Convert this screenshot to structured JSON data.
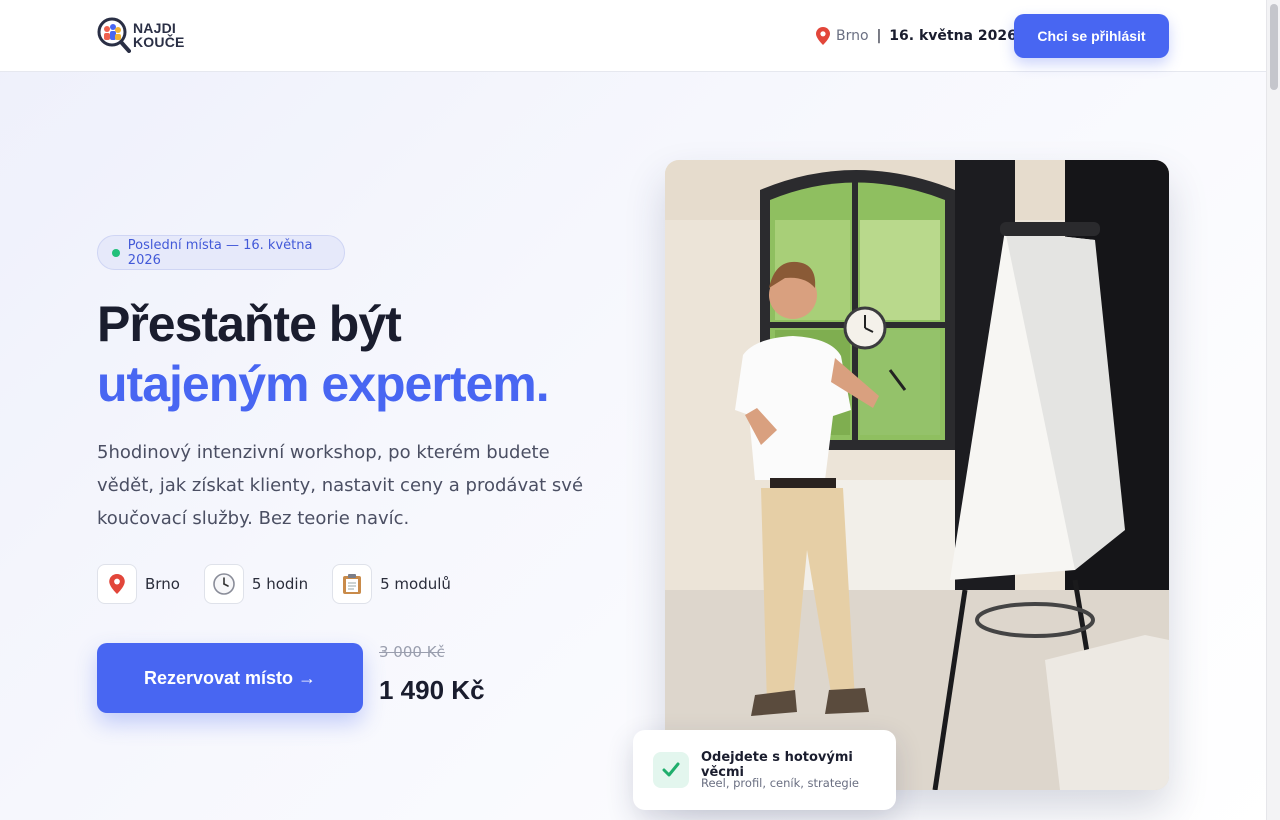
{
  "header": {
    "logo_line1": "NAJDI",
    "logo_line2": "KOUČE",
    "city": "Brno",
    "separator": "|",
    "date": "16. května 2026",
    "signup_label": "Chci se přihlásit"
  },
  "hero": {
    "badge": "Poslední místa — 16. května 2026",
    "headline_line1": "Přestaňte být",
    "headline_line2": "utajeným expertem.",
    "lead": "5hodinový intenzivní workshop, po kterém budete vědět, jak získat klienty, nastavit ceny a prodávat své koučovací služby. Bez teorie navíc.",
    "features": [
      {
        "icon": "pin-icon",
        "label": "Brno"
      },
      {
        "icon": "clock-icon",
        "label": "5 hodin"
      },
      {
        "icon": "clipboard-icon",
        "label": "5 modulů"
      }
    ],
    "cta_label": "Rezervovat místo →",
    "price_old": "3 000 Kč",
    "price_new": "1 490 Kč"
  },
  "card": {
    "icon": "check-icon",
    "title": "Odejdete s hotovými věcmi",
    "subtitle": "Reel, profil, ceník, strategie"
  },
  "colors": {
    "accent": "#4866f2",
    "headline_dark": "#1a1d2e",
    "badge_dot": "#22c07a",
    "check": "#1fae6c"
  }
}
